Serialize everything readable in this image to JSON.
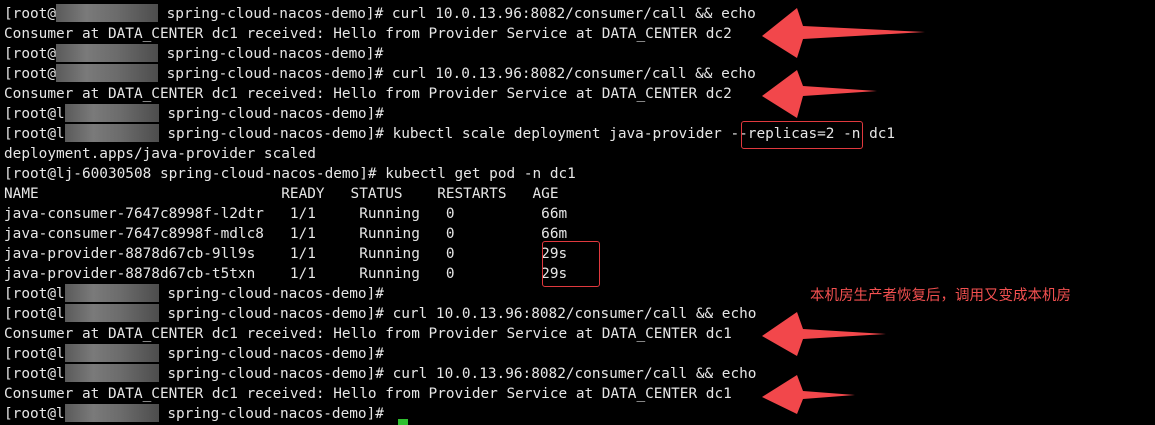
{
  "terminal": {
    "lines": [
      {
        "prefix": "[root@",
        "suffix": " spring-cloud-nacos-demo]# curl 10.0.13.96:8082/consumer/call && echo"
      },
      {
        "text": "Consumer at DATA_CENTER dc1 received: Hello from Provider Service at DATA_CENTER dc2"
      },
      {
        "prefix": "[root@",
        "suffix": " spring-cloud-nacos-demo]#"
      },
      {
        "prefix": "[root@",
        "suffix": " spring-cloud-nacos-demo]# curl 10.0.13.96:8082/consumer/call && echo"
      },
      {
        "text": "Consumer at DATA_CENTER dc1 received: Hello from Provider Service at DATA_CENTER dc2"
      },
      {
        "prefix": "[root@l",
        "suffix": " spring-cloud-nacos-demo]#"
      },
      {
        "prefix": "[root@l",
        "suffix": " spring-cloud-nacos-demo]# kubectl scale deployment java-provider --replicas=2 -n dc1"
      },
      {
        "text": "deployment.apps/java-provider scaled"
      },
      {
        "text": "[root@lj-60030508 spring-cloud-nacos-demo]# kubectl get pod -n dc1"
      },
      {
        "text": "NAME                            READY   STATUS    RESTARTS   AGE"
      },
      {
        "text": "java-consumer-7647c8998f-l2dtr   1/1     Running   0          66m"
      },
      {
        "text": "java-consumer-7647c8998f-mdlc8   1/1     Running   0          66m"
      },
      {
        "text": "java-provider-8878d67cb-9ll9s    1/1     Running   0          29s"
      },
      {
        "text": "java-provider-8878d67cb-t5txn    1/1     Running   0          29s"
      },
      {
        "prefix": "[root@l",
        "suffix": " spring-cloud-nacos-demo]#"
      },
      {
        "prefix": "[root@l",
        "suffix": " spring-cloud-nacos-demo]# curl 10.0.13.96:8082/consumer/call && echo"
      },
      {
        "text": "Consumer at DATA_CENTER dc1 received: Hello from Provider Service at DATA_CENTER dc1"
      },
      {
        "prefix": "[root@l",
        "suffix": " spring-cloud-nacos-demo]#"
      },
      {
        "prefix": "[root@l",
        "suffix": " spring-cloud-nacos-demo]# curl 10.0.13.96:8082/consumer/call && echo"
      },
      {
        "text": "Consumer at DATA_CENTER dc1 received: Hello from Provider Service at DATA_CENTER dc1"
      },
      {
        "prefix": "[root@l",
        "suffix": " spring-cloud-nacos-demo]#"
      }
    ]
  },
  "annotation": {
    "note": "本机房生产者恢复后，调用又变成本机房",
    "color": "#f25050"
  },
  "colors": {
    "background": "#000000",
    "text": "#e6e6e6",
    "highlight": "#e0393e",
    "cursor": "#2fbf2f"
  }
}
